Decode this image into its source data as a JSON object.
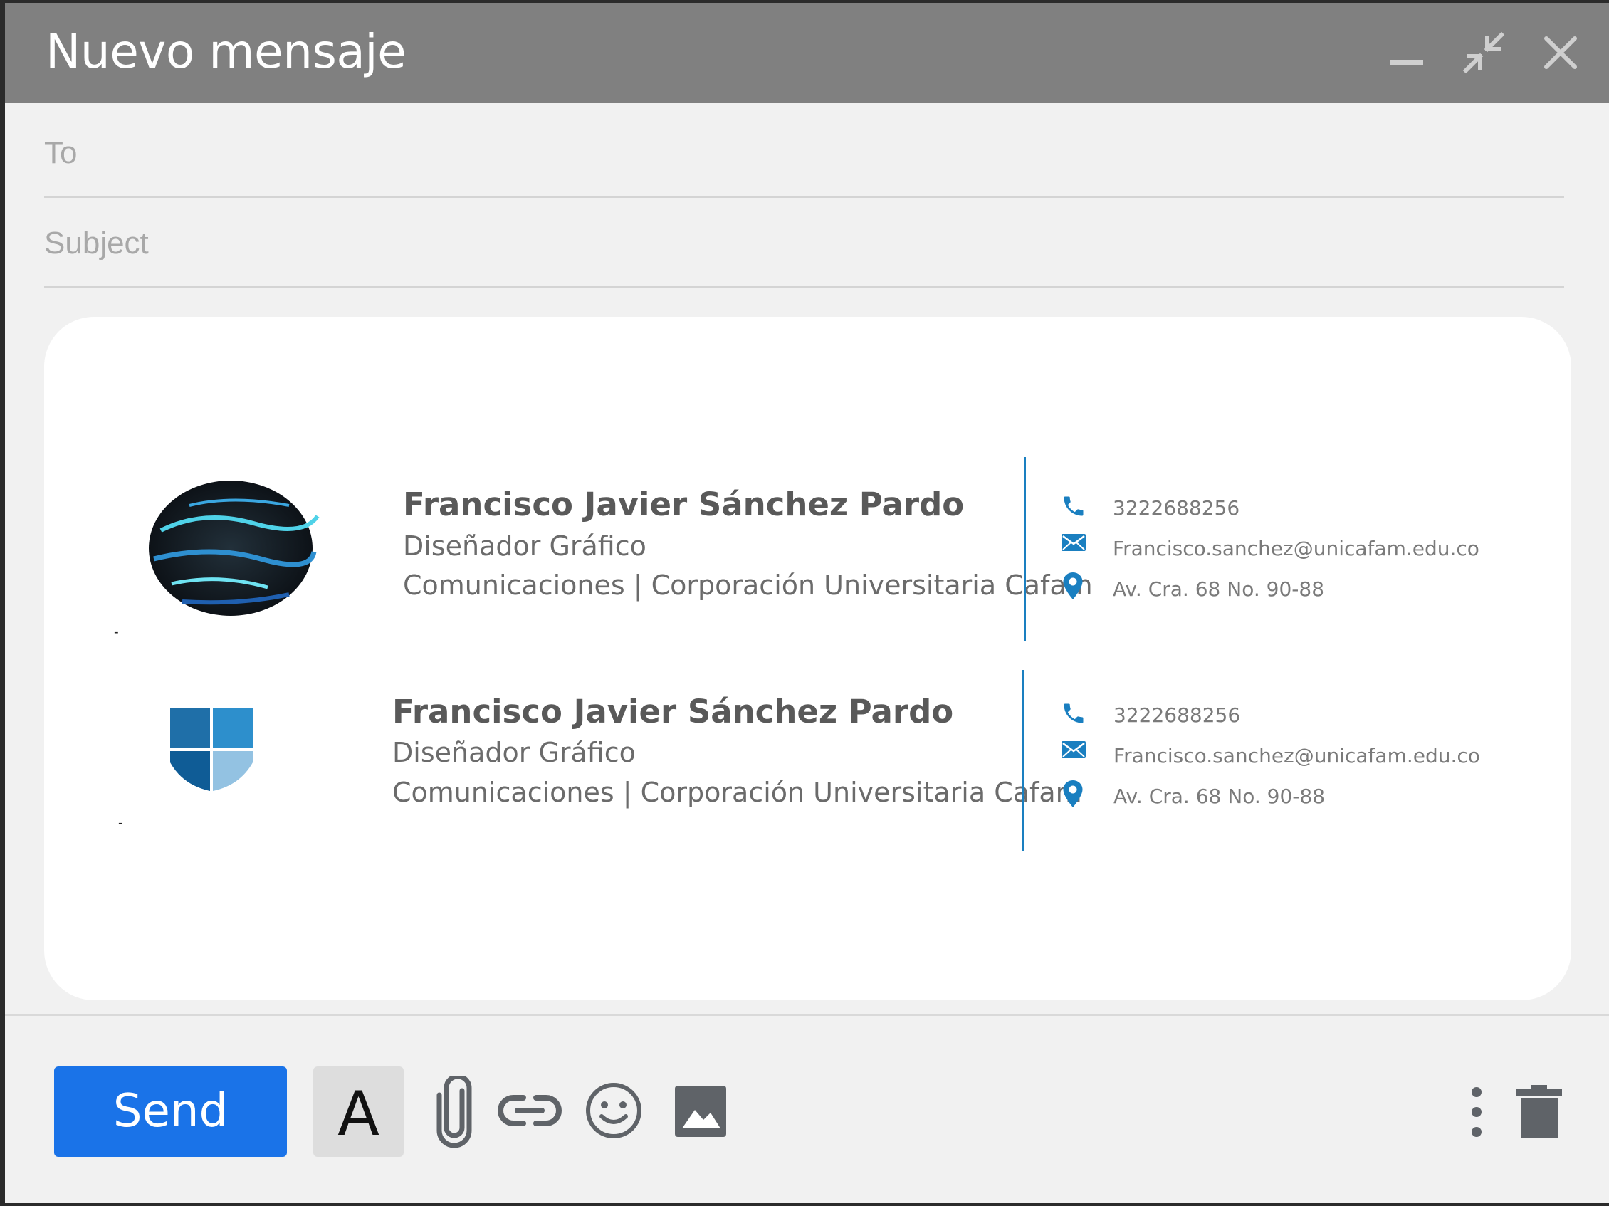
{
  "window": {
    "title": "Nuevo mensaje"
  },
  "fields": {
    "to_placeholder": "To",
    "subject_placeholder": "Subject"
  },
  "signatures": [
    {
      "name": "Francisco Javier Sánchez Pardo",
      "role": "Diseñador Gráfico",
      "department": "Comunicaciones | Corporación Universitaria Cafam",
      "phone": "3222688256",
      "email": "Francisco.sanchez@unicafam.edu.co",
      "address": "Av. Cra. 68 No. 90-88"
    },
    {
      "name": "Francisco Javier Sánchez Pardo",
      "role": "Diseñador Gráfico",
      "department": "Comunicaciones | Corporación Universitaria Cafam",
      "phone": "3222688256",
      "email": "Francisco.sanchez@unicafam.edu.co",
      "address": "Av. Cra. 68 No. 90-88"
    }
  ],
  "toolbar": {
    "send_label": "Send",
    "format_label": "A"
  },
  "colors": {
    "titlebar": "#808080",
    "send": "#1a73e8",
    "accent_blue": "#1a7fc0"
  }
}
